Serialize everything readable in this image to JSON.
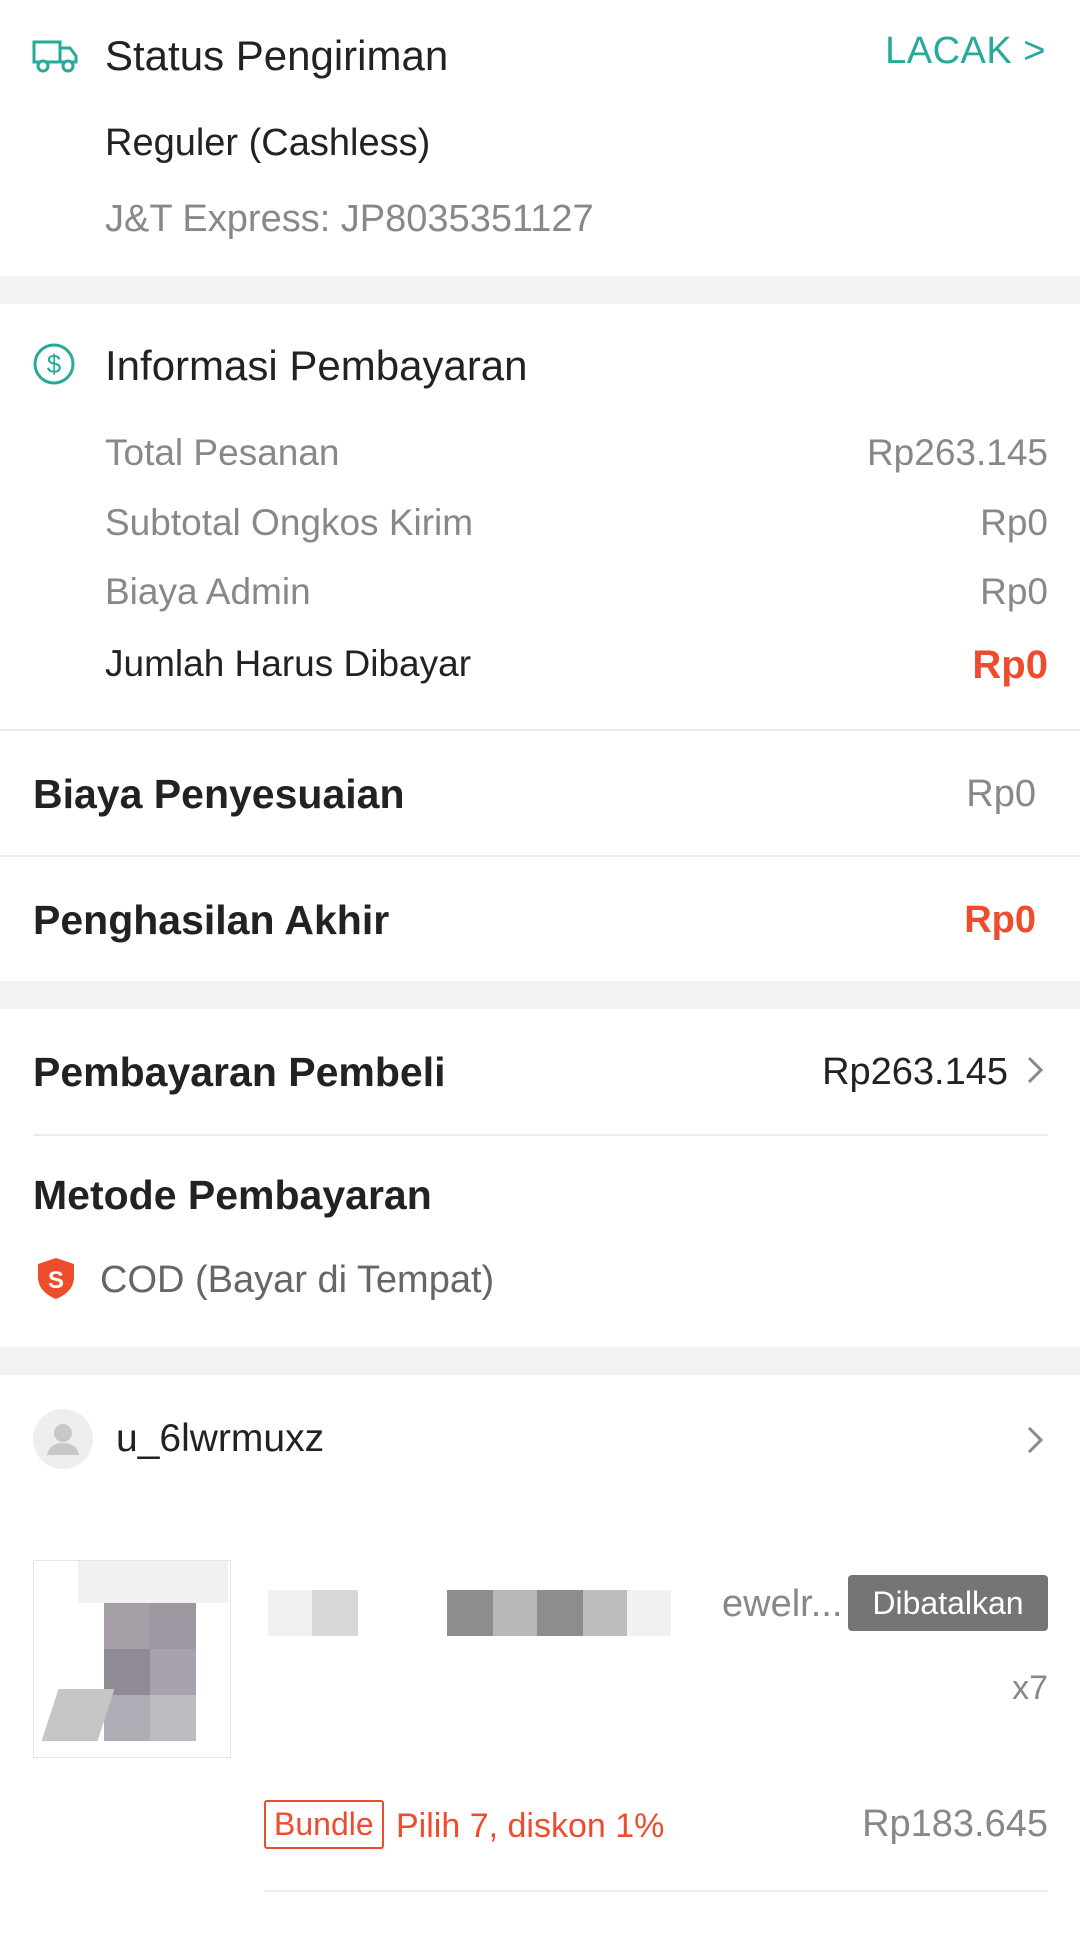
{
  "shipping": {
    "title": "Status Pengiriman",
    "track_label": "LACAK >",
    "service": "Reguler (Cashless)",
    "courier": "J&T Express: JP8035351127",
    "accent": "#26aa99"
  },
  "payment_info": {
    "title": "Informasi Pembayaran",
    "rows": [
      {
        "label": "Total Pesanan",
        "value": "Rp263.145"
      },
      {
        "label": "Subtotal Ongkos Kirim",
        "value": "Rp0"
      },
      {
        "label": "Biaya Admin",
        "value": "Rp0"
      },
      {
        "label": "Jumlah Harus Dibayar",
        "value": "Rp0"
      }
    ]
  },
  "adjustment": {
    "label": "Biaya Penyesuaian",
    "value": "Rp0"
  },
  "final_income": {
    "label": "Penghasilan Akhir",
    "value": "Rp0"
  },
  "buyer_payment": {
    "label": "Pembayaran Pembeli",
    "value": "Rp263.145"
  },
  "payment_method": {
    "title": "Metode Pembayaran",
    "value": "COD (Bayar di Tempat)"
  },
  "buyer": {
    "username": "u_6lwrmuxz"
  },
  "product": {
    "name_suffix": "ewelr...",
    "status": "Dibatalkan",
    "qty": "x7",
    "bundle_tag": "Bundle",
    "bundle_desc": "Pilih 7, diskon 1%",
    "price": "Rp183.645"
  },
  "colors": {
    "brand": "#ee4d2d",
    "teal": "#26aa99",
    "muted": "#888888"
  }
}
